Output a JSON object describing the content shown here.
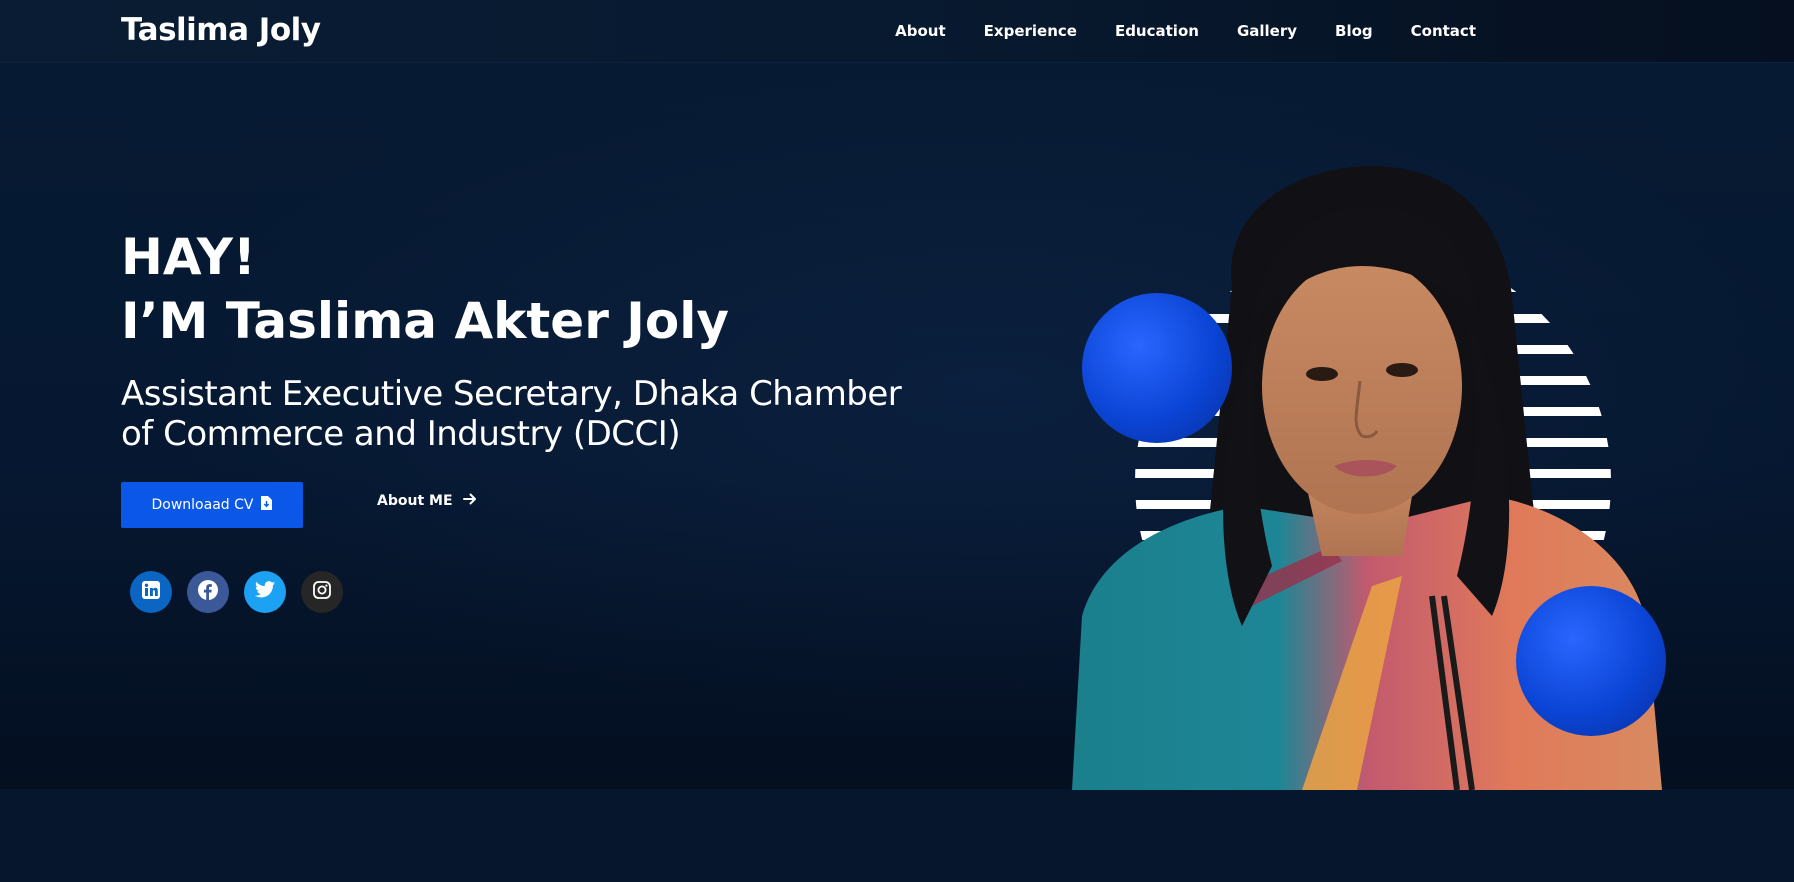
{
  "header": {
    "brand": "Taslima Joly",
    "nav": [
      "About",
      "Experience",
      "Education",
      "Gallery",
      "Blog",
      "Contact"
    ]
  },
  "hero": {
    "greeting_line1": "HAY!",
    "greeting_line2": "I’M Taslima Akter Joly",
    "subtitle": "Assistant Executive Secretary, Dhaka Chamber of Commerce and Industry (DCCI)",
    "cv_button": "Downloaad CV",
    "about_link": "About ME"
  },
  "socials": [
    {
      "name": "linkedin",
      "color": "#0a66c2"
    },
    {
      "name": "facebook",
      "color": "#3b5998"
    },
    {
      "name": "twitter",
      "color": "#1da1f2"
    },
    {
      "name": "instagram",
      "color": "#262626"
    }
  ],
  "colors": {
    "accent": "#0b58e8",
    "background": "#061428",
    "ball": "#0b45d6"
  }
}
